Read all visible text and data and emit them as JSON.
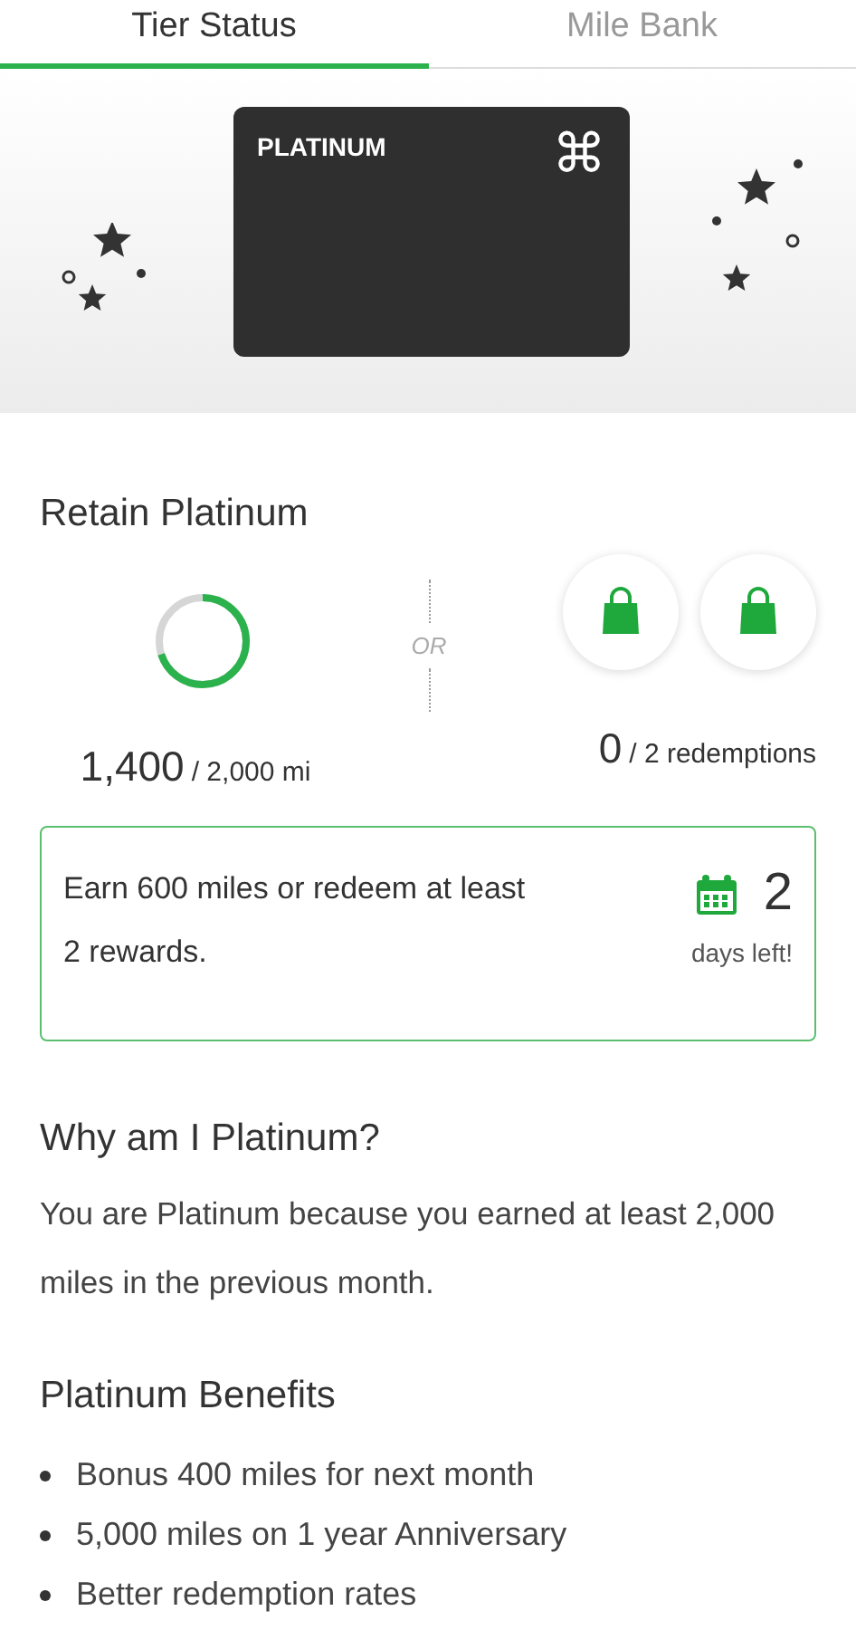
{
  "tabs": [
    {
      "label": "Tier Status",
      "selected": true
    },
    {
      "label": "Mile Bank",
      "selected": false
    }
  ],
  "card": {
    "tier": "PLATINUM",
    "logo_glyph": "⌘"
  },
  "retain": {
    "title": "Retain Platinum",
    "miles": {
      "level": 0.7,
      "value": "1,400",
      "target": "/ 2,000 mi"
    },
    "separator": "OR",
    "redemptions": {
      "bags": [
        {
          "kind": "bag"
        },
        {
          "kind": "bag"
        }
      ],
      "value": "0",
      "target": "/ 2 redemptions"
    },
    "goal": {
      "text": "Earn 600 miles or redeem at least 2 rewards.",
      "days": "2",
      "days_label": "days left!"
    }
  },
  "why": {
    "title": "Why am I Platinum?",
    "text": "You are Platinum because you earned at least 2,000 miles in the previous month."
  },
  "benefits": {
    "title": "Platinum Benefits",
    "items": [
      "Bonus 400 miles for next month",
      "5,000 miles on 1 year Anniversary",
      "Better redemption rates"
    ]
  }
}
